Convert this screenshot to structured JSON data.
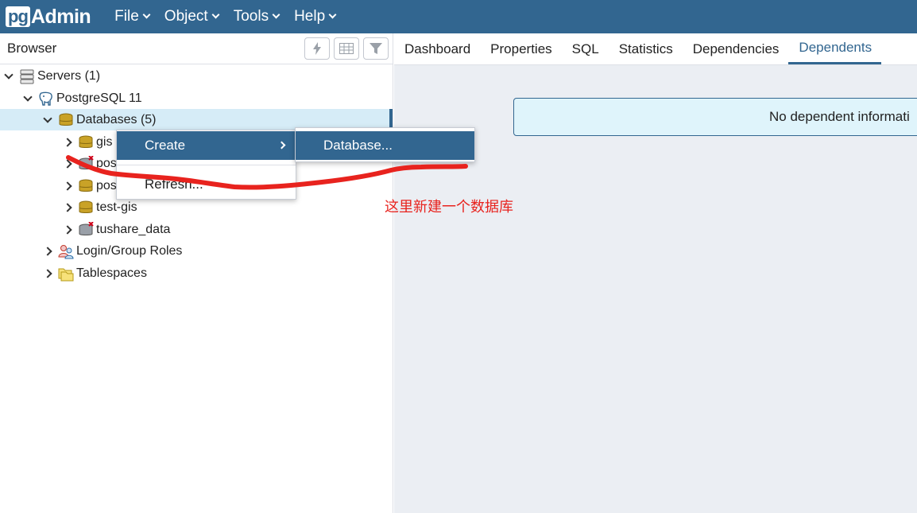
{
  "navbar": {
    "logo_pg": "pg",
    "logo_admin": "Admin",
    "menu": [
      "File",
      "Object",
      "Tools",
      "Help"
    ]
  },
  "browser": {
    "title": "Browser",
    "tools": [
      "query-tool-icon",
      "view-data-icon",
      "filter-icon"
    ],
    "tree": {
      "servers": "Servers (1)",
      "server": "PostgreSQL 11",
      "databases": "Databases (5)",
      "db_items": [
        "gis",
        "pos",
        "pos",
        "test-gis",
        "tushare_data"
      ],
      "login_roles": "Login/Group Roles",
      "tablespaces": "Tablespaces"
    }
  },
  "tabs": [
    "Dashboard",
    "Properties",
    "SQL",
    "Statistics",
    "Dependencies",
    "Dependents"
  ],
  "active_tab": "Dependents",
  "info_message": "No dependent informati",
  "context_menu": {
    "create": "Create",
    "refresh": "Refresh...",
    "submenu_database": "Database..."
  },
  "annotation": "这里新建一个数据库",
  "colors": {
    "brand": "#326690",
    "selection": "#d6ecf7",
    "annotation": "#e8231e",
    "db_icon": "#c9a227"
  }
}
